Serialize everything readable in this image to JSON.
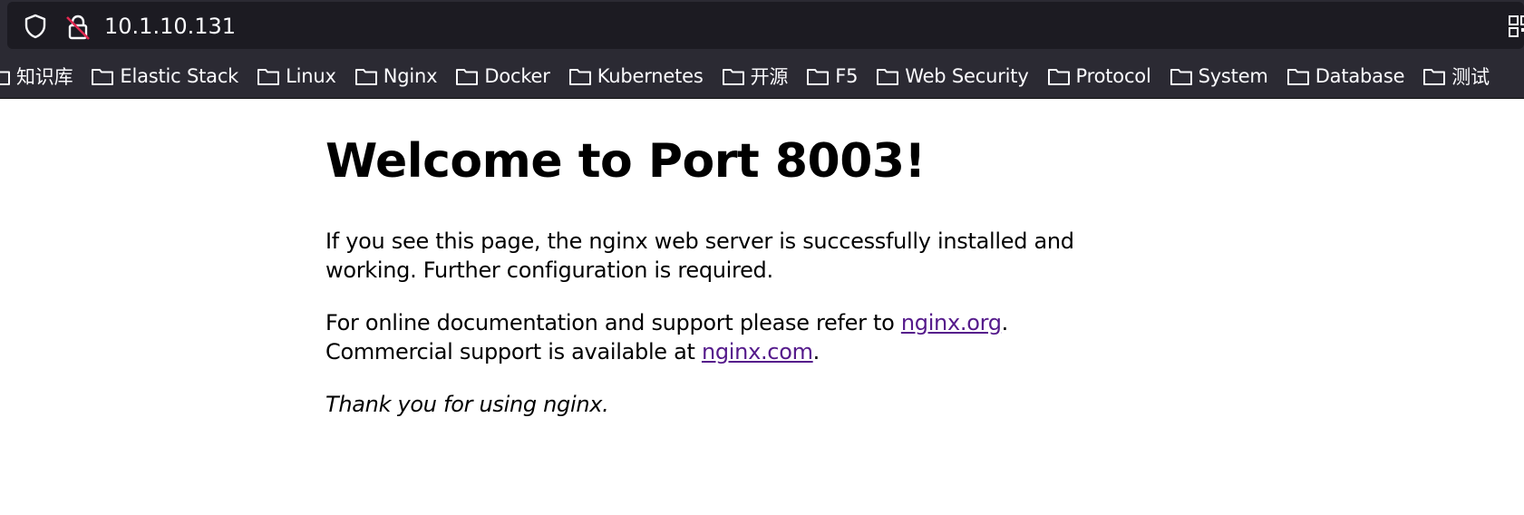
{
  "toolbar": {
    "url": "10.1.10.131"
  },
  "bookmarks": [
    {
      "label": "知识库"
    },
    {
      "label": "Elastic Stack"
    },
    {
      "label": "Linux"
    },
    {
      "label": "Nginx"
    },
    {
      "label": "Docker"
    },
    {
      "label": "Kubernetes"
    },
    {
      "label": "开源"
    },
    {
      "label": "F5"
    },
    {
      "label": "Web Security"
    },
    {
      "label": "Protocol"
    },
    {
      "label": "System"
    },
    {
      "label": "Database"
    },
    {
      "label": "测试"
    }
  ],
  "page": {
    "heading": "Welcome to Port 8003!",
    "para1": "If you see this page, the nginx web server is successfully installed and working. Further configuration is required.",
    "para2_prefix": "For online documentation and support please refer to ",
    "link_org": "nginx.org",
    "para2_mid": ".",
    "para2_line2_prefix": "Commercial support is available at ",
    "link_com": "nginx.com",
    "para2_end": ".",
    "para3": "Thank you for using nginx."
  },
  "colors": {
    "chrome_bg": "#2b2a33",
    "urlbar_bg": "#1c1b22",
    "link": "#551a8b"
  }
}
